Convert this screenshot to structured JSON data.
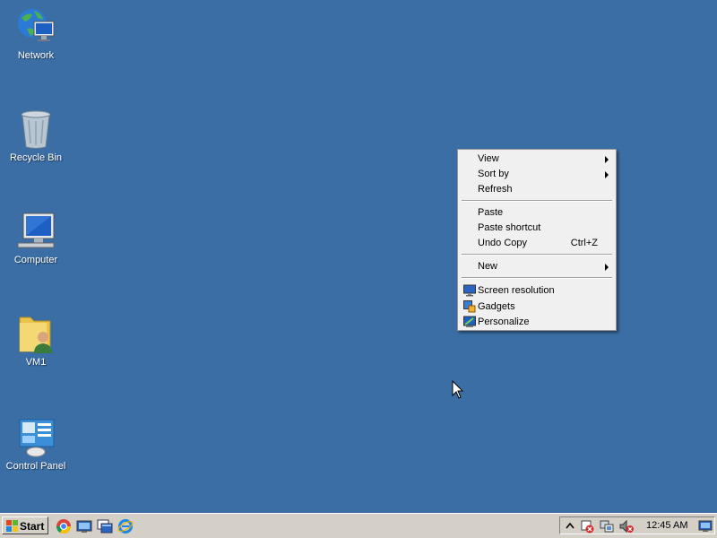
{
  "desktop": {
    "background": "#3a6ea5",
    "icons": [
      {
        "label": "Network",
        "icon": "network-icon"
      },
      {
        "label": "Recycle Bin",
        "icon": "recycle-bin-icon"
      },
      {
        "label": "Computer",
        "icon": "computer-icon"
      },
      {
        "label": "VM1",
        "icon": "user-folder-icon"
      },
      {
        "label": "Control Panel",
        "icon": "control-panel-icon"
      }
    ]
  },
  "context_menu": {
    "items": [
      {
        "label": "View",
        "submenu": true
      },
      {
        "label": "Sort by",
        "submenu": true
      },
      {
        "label": "Refresh"
      },
      {
        "label": "Paste"
      },
      {
        "label": "Paste shortcut"
      },
      {
        "label": "Undo Copy",
        "shortcut": "Ctrl+Z"
      },
      {
        "label": "New",
        "submenu": true
      },
      {
        "label": "Screen resolution",
        "icon": "screen-resolution-icon"
      },
      {
        "label": "Gadgets",
        "icon": "gadgets-icon"
      },
      {
        "label": "Personalize",
        "icon": "personalize-icon"
      }
    ]
  },
  "taskbar": {
    "start_label": "Start",
    "quick_launch": [
      "chrome-icon",
      "show-desktop-icon",
      "switch-windows-icon",
      "internet-explorer-icon"
    ],
    "tray": {
      "icons": [
        "show-hidden-icons-icon",
        "action-center-icon",
        "network-status-icon",
        "volume-muted-icon"
      ],
      "clock": "12:45 AM"
    }
  }
}
